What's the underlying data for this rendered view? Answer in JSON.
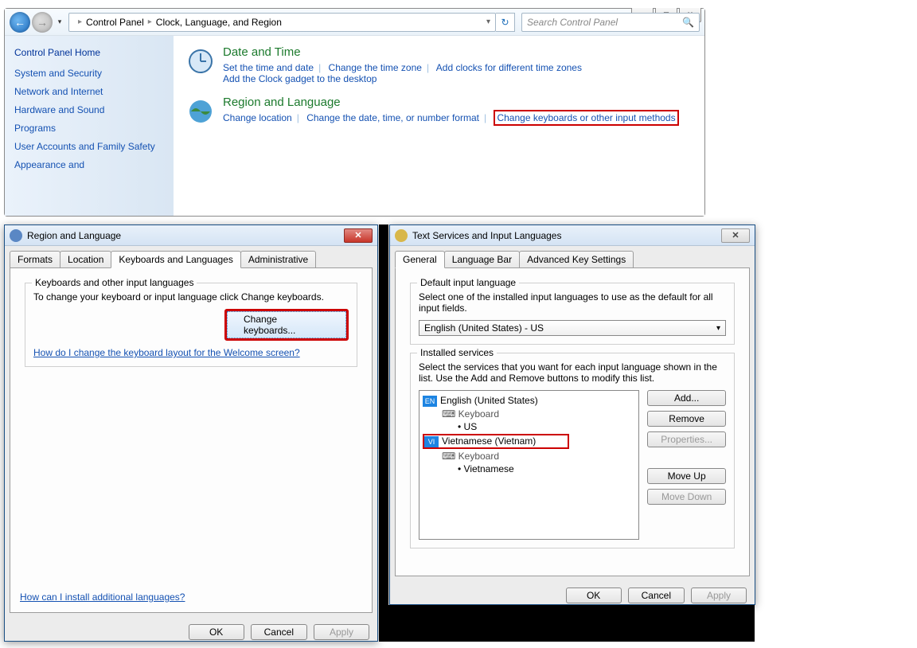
{
  "cp": {
    "title_btn_min": "—",
    "title_btn_max": "▢",
    "title_btn_close": "✕",
    "breadcrumb1": "Control Panel",
    "breadcrumb2": "Clock, Language, and Region",
    "search_placeholder": "Search Control Panel",
    "side": {
      "home": "Control Panel Home",
      "links": [
        "System and Security",
        "Network and Internet",
        "Hardware and Sound",
        "Programs",
        "User Accounts and Family Safety",
        "Appearance and"
      ]
    },
    "cat1": {
      "title": "Date and Time",
      "links": [
        "Set the time and date",
        "Change the time zone",
        "Add clocks for different time zones",
        "Add the Clock gadget to the desktop"
      ]
    },
    "cat2": {
      "title": "Region and Language",
      "links": [
        "Change location",
        "Change the date, time, or number format",
        "Change keyboards or other input methods"
      ]
    }
  },
  "rgn": {
    "title": "Region and Language",
    "tabs": [
      "Formats",
      "Location",
      "Keyboards and Languages",
      "Administrative"
    ],
    "group_title": "Keyboards and other input languages",
    "desc": "To change your keyboard or input language click Change keyboards.",
    "change_btn": "Change keyboards...",
    "help1": "How do I change the keyboard layout for the Welcome screen?",
    "help2": "How can I install additional languages?",
    "ok": "OK",
    "cancel": "Cancel",
    "apply": "Apply"
  },
  "tsv": {
    "title": "Text Services and Input Languages",
    "tabs": [
      "General",
      "Language Bar",
      "Advanced Key Settings"
    ],
    "grp1_title": "Default input language",
    "grp1_desc": "Select one of the installed input languages to use as the default for all input fields.",
    "default_lang": "English (United States) - US",
    "grp2_title": "Installed services",
    "grp2_desc": "Select the services that you want for each input language shown in the list. Use the Add and Remove buttons to modify this list.",
    "lang_en_badge": "EN",
    "lang_en": "English (United States)",
    "kb_label": "Keyboard",
    "kb_us": "US",
    "lang_vi_badge": "VI",
    "lang_vi": "Vietnamese (Vietnam)",
    "kb_vi": "Vietnamese",
    "btns": {
      "add": "Add...",
      "remove": "Remove",
      "props": "Properties...",
      "up": "Move Up",
      "down": "Move Down"
    },
    "ok": "OK",
    "cancel": "Cancel",
    "apply": "Apply"
  }
}
